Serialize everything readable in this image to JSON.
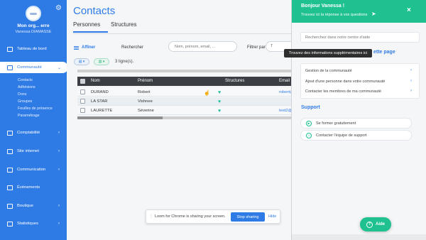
{
  "sidebar": {
    "org_name": "Mon org... erre",
    "user_name": "Vanessa DIAMASSE",
    "items": [
      {
        "label": "Tableau de bord"
      },
      {
        "label": "Communauté",
        "chevron": "⌄"
      },
      {
        "label": "Comptabilité",
        "chevron": "›"
      },
      {
        "label": "Site internet",
        "chevron": "›"
      },
      {
        "label": "Communication",
        "chevron": "›"
      },
      {
        "label": "Événements"
      },
      {
        "label": "Boutique",
        "chevron": "›"
      },
      {
        "label": "Statistiques",
        "chevron": "›"
      }
    ],
    "subitems": [
      "Contacts",
      "Adhésions",
      "Dons",
      "Groupes",
      "Feuilles de présence",
      "Paramétrage"
    ]
  },
  "main": {
    "title": "Contacts",
    "tabs": [
      "Personnes",
      "Structures"
    ],
    "affiner": "Affiner",
    "search_label": "Rechercher",
    "search_placeholder": "Nom, prénom, email, ...",
    "filter_label": "Filtrer par",
    "filter_value": "T",
    "row_count": "3 ligne(s).",
    "columns": [
      "Nom",
      "Prénom",
      "Structures",
      "Email"
    ],
    "rows": [
      {
        "nom": "DURAND",
        "prenom": "Robert",
        "email": "robert@"
      },
      {
        "nom": "LA STAR",
        "prenom": "Vishnee",
        "email": ""
      },
      {
        "nom": "LAURETTE",
        "prenom": "Séverine",
        "email": "test2@"
      }
    ]
  },
  "loom": {
    "text": "Loom for Chrome is sharing your screen.",
    "stop": "Stop sharing",
    "hide": "Hide"
  },
  "help": {
    "title": "Bonjour Vanessa !",
    "subtitle": "Trouvez ici la réponse à vos questions",
    "close": "×",
    "search_placeholder": "Recherchez dans notre centre d'aide",
    "tooltip": "Trouvez des informations supplémentaires ici",
    "section_fragment": "ette page",
    "links": [
      "Gestion de la communauté",
      "Ajout d'une personne dans votre communauté",
      "Contacter les membres de ma communauté"
    ],
    "support_title": "Support",
    "support_items": [
      "Se former gratuitement",
      "Contacter l'équipe de support"
    ],
    "aide_button": "Aide"
  },
  "colors": {
    "brand_blue": "#2f7be6",
    "help_green": "#1fc191"
  }
}
